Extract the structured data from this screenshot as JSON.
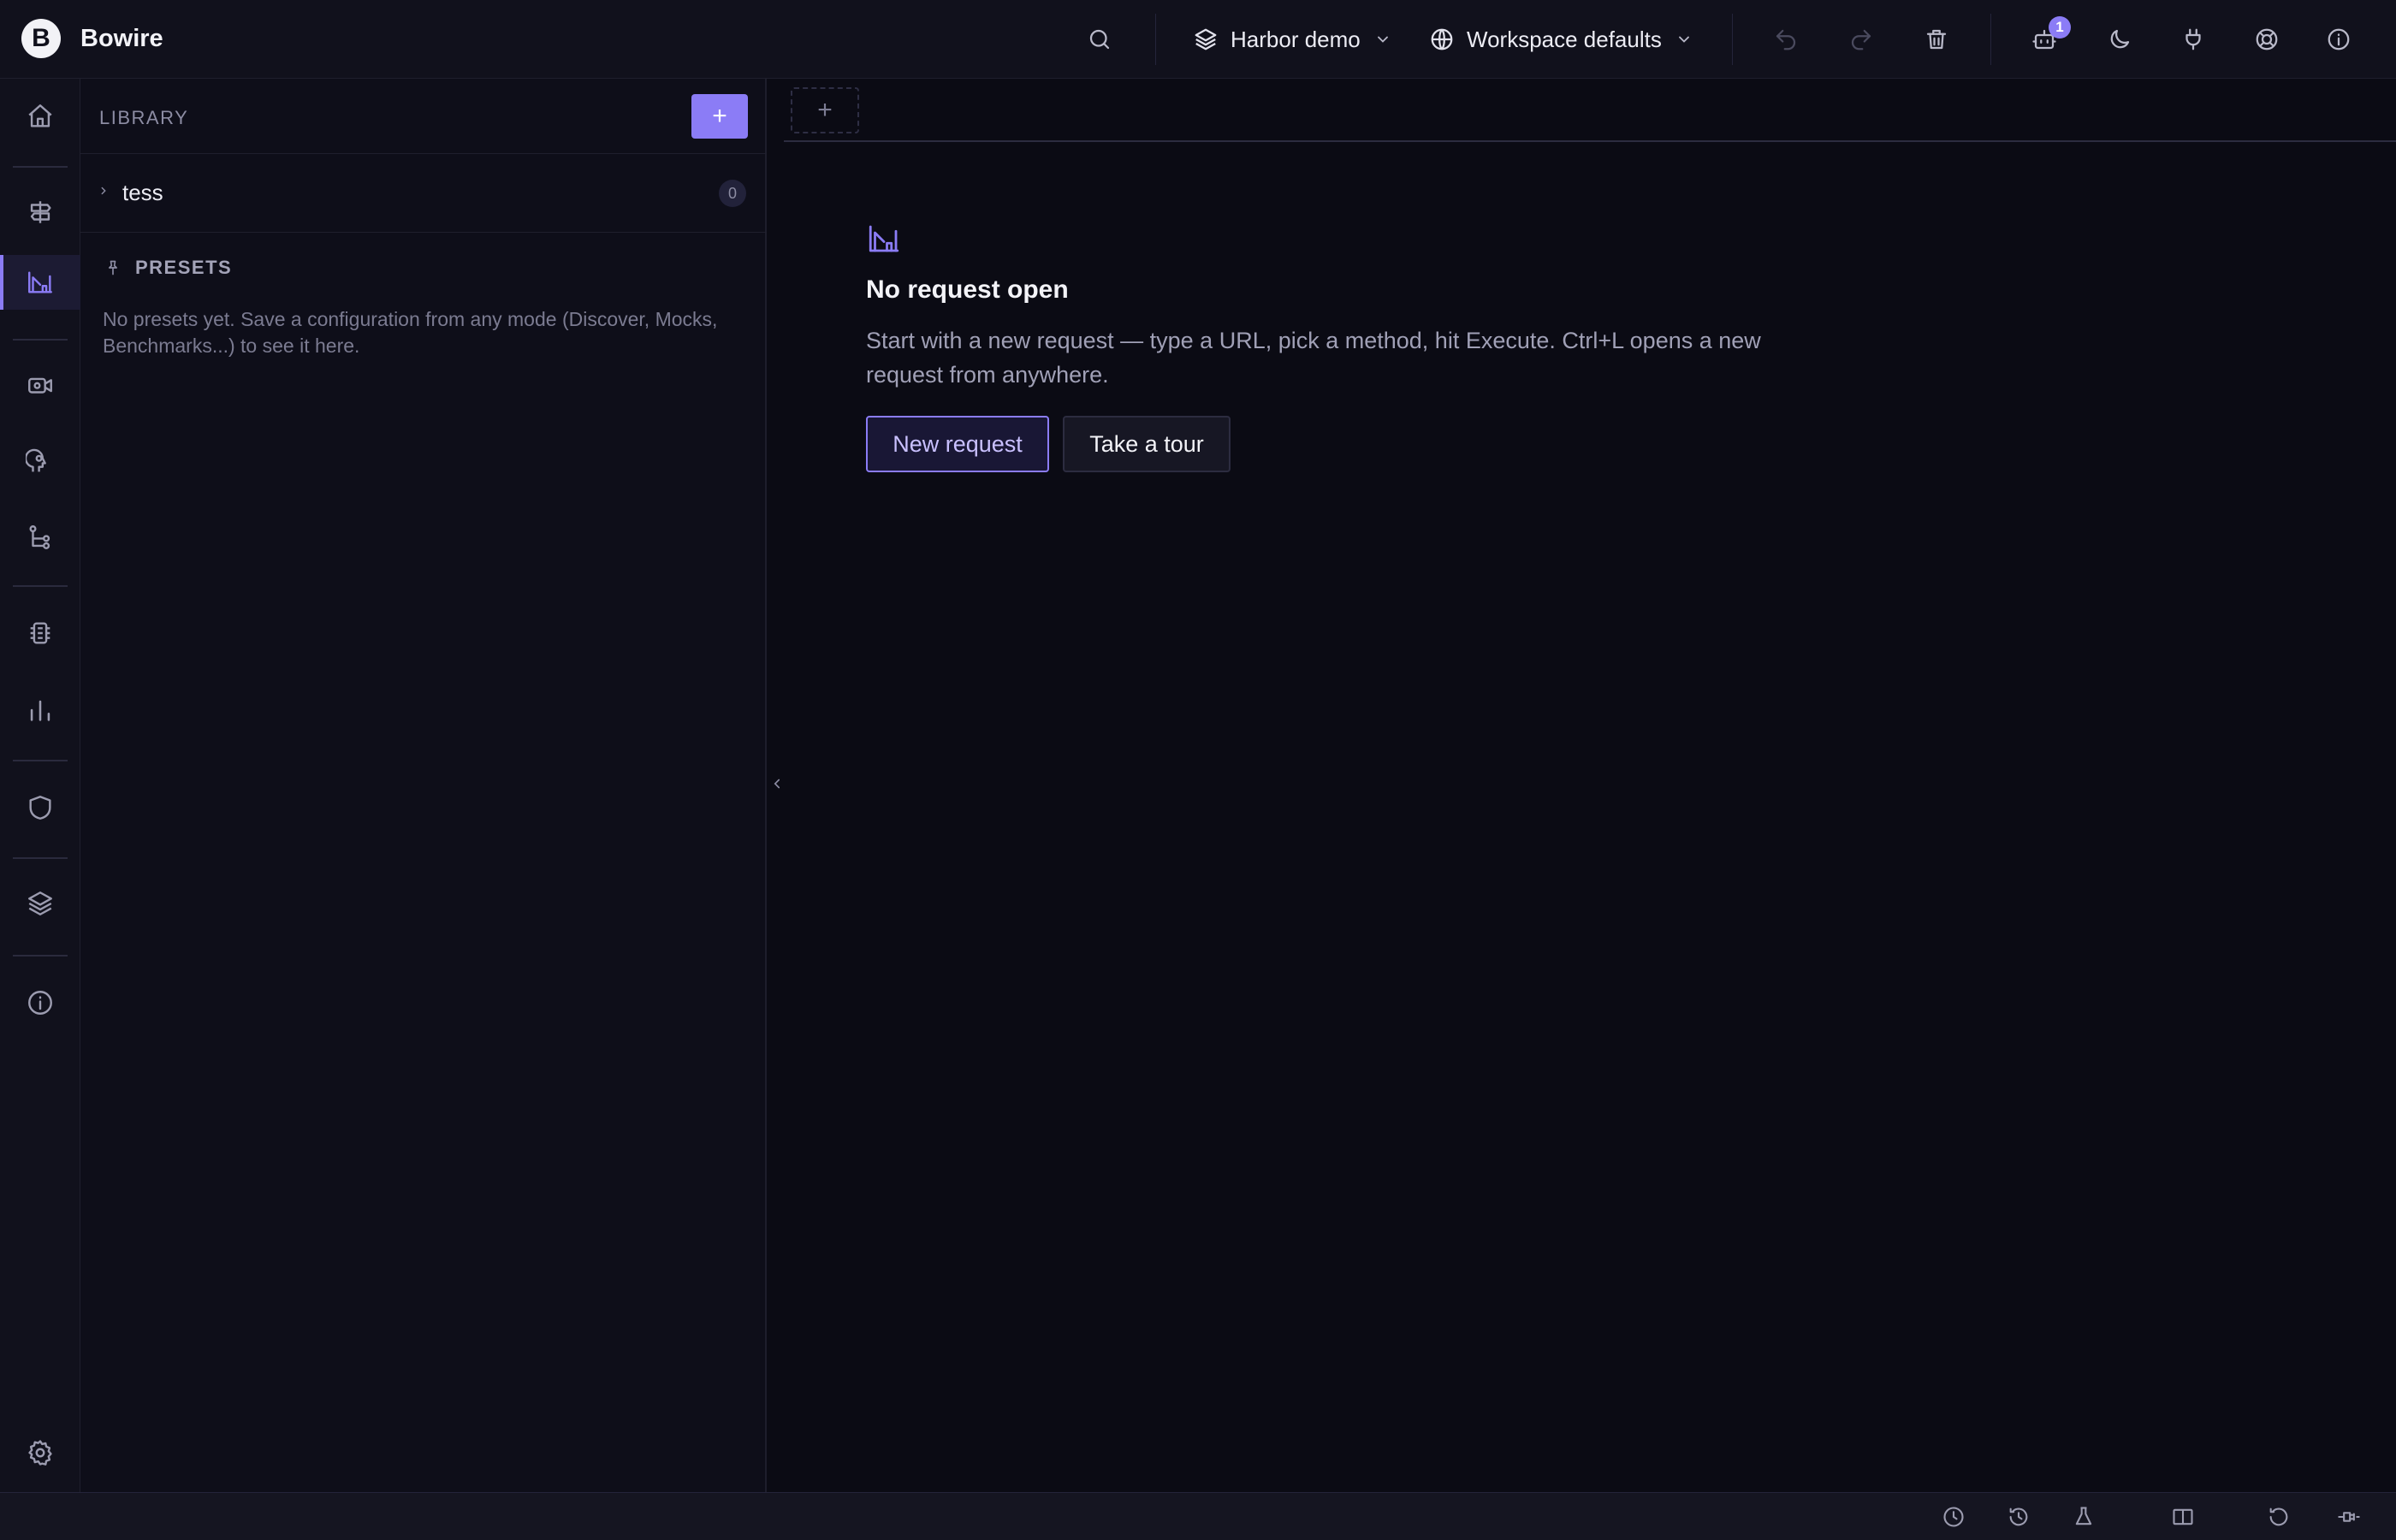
{
  "app": {
    "name": "Bowire",
    "logo_letter": "B"
  },
  "topbar": {
    "workspace": {
      "label": "Harbor demo",
      "icon": "layers-icon"
    },
    "environment": {
      "label": "Workspace defaults",
      "icon": "globe-icon"
    },
    "notification_count": "1",
    "icons": [
      "search-icon",
      "undo-icon",
      "redo-icon",
      "trash-icon",
      "bot-icon",
      "moon-icon",
      "plug-icon",
      "lifebuoy-icon",
      "info-icon"
    ]
  },
  "rail": {
    "items": [
      "home-icon",
      "signpost-icon",
      "workbench-icon",
      "recorder-icon",
      "brain-icon",
      "flow-icon",
      "chip-icon",
      "chart-icon",
      "shield-icon",
      "layers-icon",
      "info-icon",
      "gear-icon"
    ],
    "active": "workbench-icon"
  },
  "sidebar": {
    "library_title": "LIBRARY",
    "add_label": "+",
    "collections": [
      {
        "name": "tess",
        "count": "0"
      }
    ],
    "presets_title": "PRESETS",
    "presets_empty": "No presets yet. Save a configuration from any mode (Discover, Mocks, Benchmarks...) to see it here."
  },
  "main": {
    "tab_add_label": "+",
    "empty_title": "No request open",
    "empty_desc": "Start with a new request — type a URL, pick a method, hit Execute. Ctrl+L opens a new request from anywhere.",
    "new_request_label": "New request",
    "tour_label": "Take a tour"
  },
  "statusbar": {
    "icons": [
      "clock-icon",
      "history-icon",
      "flask-icon",
      "split-view-icon",
      "reset-icon",
      "plug-disconnect-icon"
    ]
  },
  "colors": {
    "accent": "#8b7cf6",
    "background": "#0b0b14",
    "panel": "#11111c",
    "sidebar": "#0e0e19",
    "text": "#ececf4",
    "muted": "#8c8ca3"
  }
}
